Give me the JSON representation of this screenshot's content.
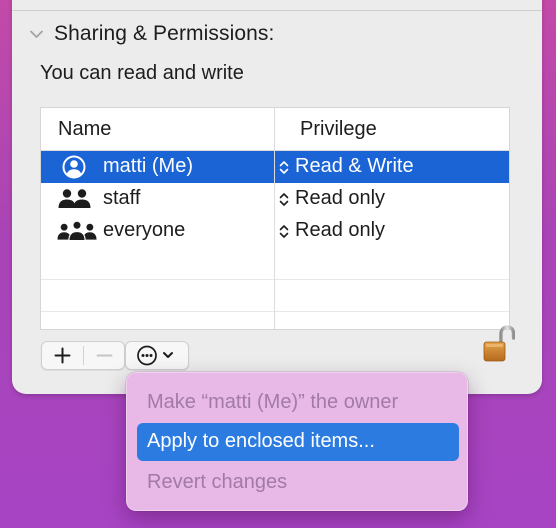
{
  "section": {
    "title": "Sharing & Permissions:",
    "access_text": "You can read and write"
  },
  "table": {
    "columns": [
      "Name",
      "Privilege"
    ],
    "rows": [
      {
        "name": "matti (Me)",
        "privilege": "Read & Write",
        "icon": "user-circle-icon",
        "selected": true
      },
      {
        "name": "staff",
        "privilege": "Read only",
        "icon": "group-icon",
        "selected": false
      },
      {
        "name": "everyone",
        "privilege": "Read only",
        "icon": "everyone-group-icon",
        "selected": false
      }
    ]
  },
  "toolbar": {
    "add_icon": "plus-icon",
    "remove_icon": "minus-icon",
    "action_icon": "ellipsis-circle-icon",
    "lock_icon": "unlocked-padlock-icon"
  },
  "context_menu": {
    "items": [
      {
        "label": "Make “matti (Me)” the owner",
        "enabled": false,
        "highlighted": false
      },
      {
        "label": "Apply to enclosed items...",
        "enabled": true,
        "highlighted": true
      },
      {
        "label": "Revert changes",
        "enabled": false,
        "highlighted": false
      }
    ]
  },
  "colors": {
    "selection": "#1a64d6",
    "menu_highlight": "#2c7be0",
    "menu_background": "#e8b9e6",
    "desktop": "#a944b6"
  }
}
